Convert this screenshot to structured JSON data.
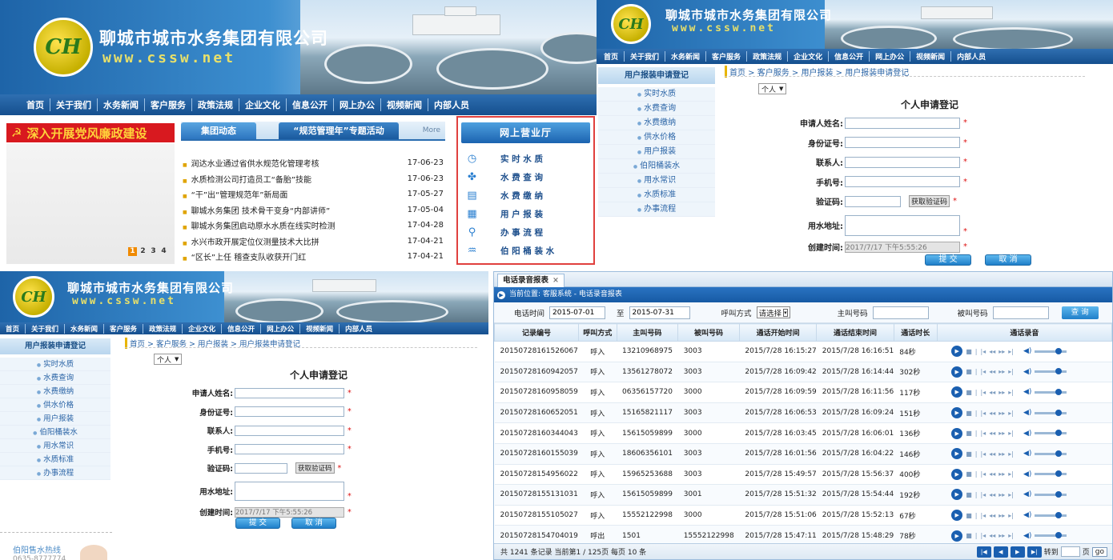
{
  "company": {
    "name": "聊城市城市水务集团有限公司",
    "url": "www.cssw.net",
    "logo_text": "CH"
  },
  "nav": [
    "首页",
    "关于我们",
    "水务新闻",
    "客户服务",
    "政策法规",
    "企业文化",
    "信息公开",
    "网上办公",
    "视频新闻",
    "内部人员"
  ],
  "home": {
    "banner_text": "深入开展党风廉政建设",
    "tab1": "集团动态",
    "tab2": "“规范管理年”专题活动",
    "more": "More",
    "news": [
      {
        "title": "润达水业通过省供水规范化管理考核",
        "date": "17-06-23"
      },
      {
        "title": "水质检测公司打造员工“备胎”技能",
        "date": "17-06-23"
      },
      {
        "title": "“干”出“管理规范年”新局面",
        "date": "17-05-27"
      },
      {
        "title": "聊城水务集团 技术骨干变身“内部讲师”",
        "date": "17-05-04"
      },
      {
        "title": "聊城水务集团启动原水水质在线实时检测",
        "date": "17-04-28"
      },
      {
        "title": "水兴市政开展定位仪测量技术大比拼",
        "date": "17-04-21"
      },
      {
        "title": "“区长”上任 稽查支队收获开门红",
        "date": "17-04-21"
      }
    ],
    "pages": [
      "1",
      "2",
      "3",
      "4"
    ],
    "hall_title": "网上营业厅",
    "hall_items": [
      {
        "label": "实 时 水 质",
        "icon": "clock-icon"
      },
      {
        "label": "水 费 查 询",
        "icon": "puzzle-icon"
      },
      {
        "label": "水 费 缴 纳",
        "icon": "payment-icon"
      },
      {
        "label": "用 户 报 装",
        "icon": "calendar-icon"
      },
      {
        "label": "办 事 流 程",
        "icon": "magnifier-icon"
      },
      {
        "label": "伯 阳 桶 装 水",
        "icon": "water-icon"
      }
    ]
  },
  "register": {
    "sidebar_title": "用户报装申请登记",
    "sidebar_items": [
      "实时水质",
      "水费查询",
      "水费缴纳",
      "供水价格",
      "用户报装",
      "伯阳桶装水",
      "用水常识",
      "水质标准",
      "办事流程"
    ],
    "breadcrumb": "首页 > 客户服务 > 用户报装 > 用户报装申请登记",
    "type_select": "个人",
    "form_title": "个人申请登记",
    "fields": [
      {
        "label": "申请人姓名:",
        "value": ""
      },
      {
        "label": "身份证号:",
        "value": ""
      },
      {
        "label": "联系人:",
        "value": ""
      },
      {
        "label": "手机号:",
        "value": ""
      }
    ],
    "captcha_label": "验证码:",
    "captcha_button": "获取验证码",
    "address_label": "用水地址:",
    "created_label": "创建时间:",
    "created_value": "2017/7/17 下午5:55:26",
    "submit": "提 交",
    "cancel": "取 消",
    "hotline_title": "伯阳售水热线",
    "hotline_number": "0635-8777774"
  },
  "report": {
    "tab": "电话录音报表",
    "location": "当前位置: 客服系统 - 电话录音报表",
    "filter": {
      "time_label": "电话时间",
      "from": "2015-07-01",
      "to_label": "至",
      "to": "2015-07-31",
      "mode_label": "呼叫方式",
      "mode_value": "请选择",
      "caller_label": "主叫号码",
      "callee_label": "被叫号码",
      "query": "查 询"
    },
    "columns": [
      "记录编号",
      "呼叫方式",
      "主叫号码",
      "被叫号码",
      "通话开始时间",
      "通话结束时间",
      "通话时长",
      "通话录音"
    ],
    "rows": [
      [
        "20150728161526067",
        "呼入",
        "13210968975",
        "3003",
        "2015/7/28 16:15:27",
        "2015/7/28 16:16:51",
        "84秒"
      ],
      [
        "20150728160942057",
        "呼入",
        "13561278072",
        "3003",
        "2015/7/28 16:09:42",
        "2015/7/28 16:14:44",
        "302秒"
      ],
      [
        "20150728160958059",
        "呼入",
        "06356157720",
        "3000",
        "2015/7/28 16:09:59",
        "2015/7/28 16:11:56",
        "117秒"
      ],
      [
        "20150728160652051",
        "呼入",
        "15165821117",
        "3003",
        "2015/7/28 16:06:53",
        "2015/7/28 16:09:24",
        "151秒"
      ],
      [
        "20150728160344043",
        "呼入",
        "15615059899",
        "3000",
        "2015/7/28 16:03:45",
        "2015/7/28 16:06:01",
        "136秒"
      ],
      [
        "20150728160155039",
        "呼入",
        "18606356101",
        "3003",
        "2015/7/28 16:01:56",
        "2015/7/28 16:04:22",
        "146秒"
      ],
      [
        "20150728154956022",
        "呼入",
        "15965253688",
        "3003",
        "2015/7/28 15:49:57",
        "2015/7/28 15:56:37",
        "400秒"
      ],
      [
        "20150728155131031",
        "呼入",
        "15615059899",
        "3001",
        "2015/7/28 15:51:32",
        "2015/7/28 15:54:44",
        "192秒"
      ],
      [
        "20150728155105027",
        "呼入",
        "15552122998",
        "3000",
        "2015/7/28 15:51:06",
        "2015/7/28 15:52:13",
        "67秒"
      ],
      [
        "20150728154704019",
        "呼出",
        "1501",
        "15552122998",
        "2015/7/28 15:47:11",
        "2015/7/28 15:48:29",
        "78秒"
      ]
    ],
    "footer": "共 1241 条记录 当前第1 / 125页 每页 10 条",
    "goto_label": "转到",
    "page_suffix": "页",
    "go": "go"
  },
  "colors": {
    "nav": "#1f5e9e",
    "accent": "#d91e1e",
    "link": "#2a64a6",
    "hall_border": "#e0403e"
  }
}
